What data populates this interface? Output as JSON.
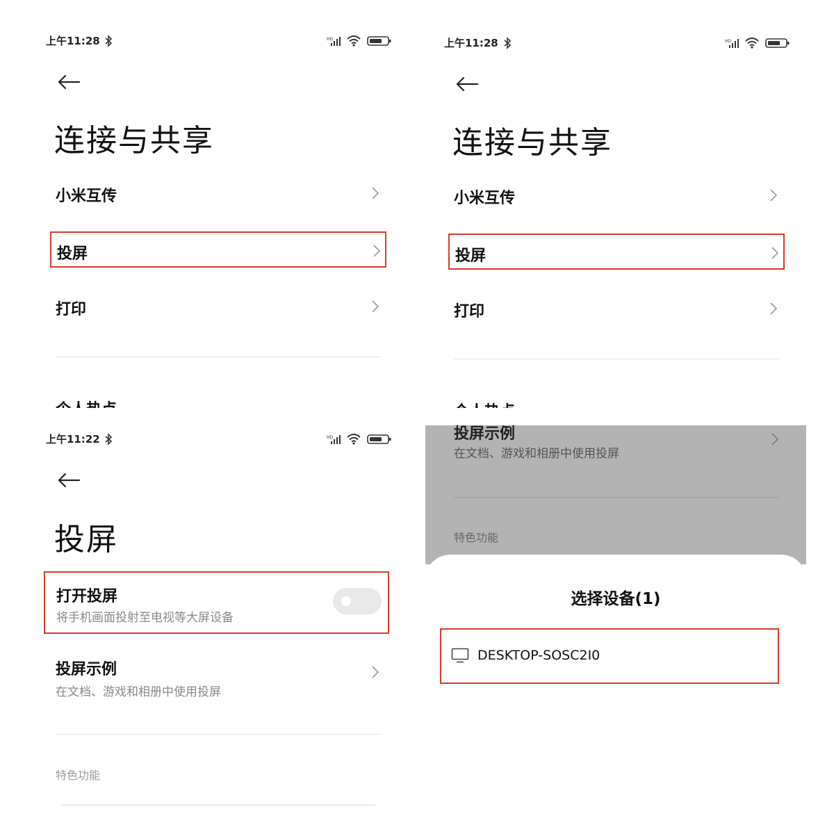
{
  "status_bars": [
    {
      "time": "上午11:28",
      "bt_icon": "bluetooth-icon",
      "signal_icon": "hd-signal-icon",
      "wifi_icon": "wifi-icon",
      "battery_icon": "battery-icon"
    },
    {
      "time": "上午11:28",
      "bt_icon": "bluetooth-icon",
      "signal_icon": "hd-signal-icon",
      "wifi_icon": "wifi-icon",
      "battery_icon": "battery-icon"
    },
    {
      "time": "上午11:22",
      "bt_icon": "bluetooth-icon",
      "signal_icon": "hd-signal-icon",
      "wifi_icon": "wifi-icon",
      "battery_icon": "battery-icon"
    }
  ],
  "connect_share": {
    "title": "连接与共享",
    "items": [
      {
        "label": "小米互传"
      },
      {
        "label": "投屏"
      },
      {
        "label": "打印"
      }
    ],
    "partial_item": "个人热点"
  },
  "cast": {
    "title": "投屏",
    "toggle": {
      "label": "打开投屏",
      "description": "将手机画面投射至电视等大屏设备",
      "on": false
    },
    "example": {
      "label": "投屏示例",
      "description": "在文档、游戏和相册中使用投屏"
    },
    "section_header": "特色功能"
  },
  "device_sheet": {
    "title": "选择设备(1)",
    "devices": [
      {
        "name": "DESKTOP-SOSC2I0",
        "icon": "monitor-icon"
      }
    ]
  },
  "colors": {
    "highlight": "#d93a2b",
    "dim_overlay": "#b3b3b3",
    "secondary_text": "#888888"
  }
}
